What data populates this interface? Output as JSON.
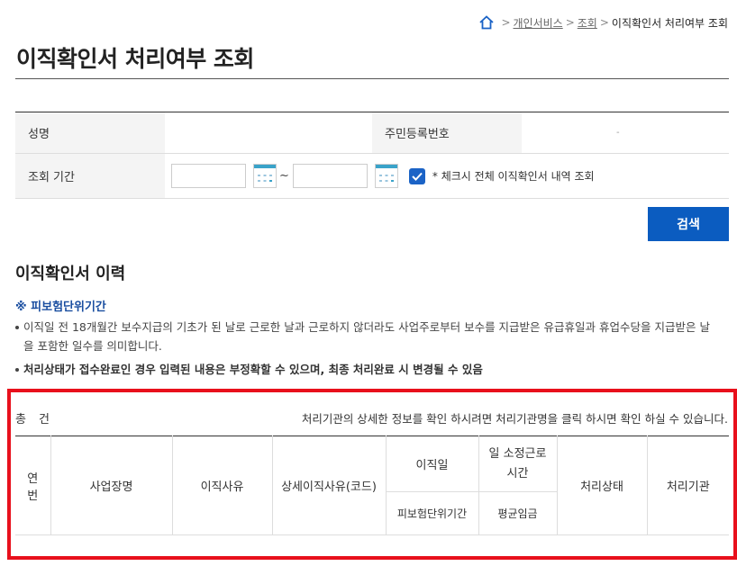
{
  "breadcrumb": {
    "home_icon": "home-icon",
    "items": [
      "개인서비스",
      "조회"
    ],
    "current": "이직확인서 처리여부 조회"
  },
  "page_title": "이직확인서 처리여부 조회",
  "form": {
    "name_label": "성명",
    "name_value": "",
    "id_label": "주민등록번호",
    "id_value": "-",
    "period_label": "조회 기간",
    "date_from": "",
    "date_to": "",
    "tilde": "~",
    "check_all_checked": true,
    "check_all_label": "* 체크시 전체 이직확인서 내역 조회"
  },
  "search_button": "검색",
  "history": {
    "section_title": "이직확인서 이력",
    "note_title": "※ 피보험단위기간",
    "bullet1": "이직일 전 18개월간 보수지급의 기초가 된 날로 근로한 날과 근로하지 않더라도 사업주로부터 보수를 지급받은 유급휴일과 휴업수당을 지급받은 날을 포함한 일수를 의미합니다.",
    "bullet2": "처리상태가 접수완료인 경우 입력된 내용은 부정확할 수 있으며, 최종 처리완료 시 변경될 수 있음"
  },
  "results": {
    "total_label": "총",
    "total_unit": "건",
    "hint": "처리기관의 상세한 정보를 확인 하시려면 처리기관명을 클릭 하시면 확인 하실 수 있습니다.",
    "headers": {
      "seq_line1": "연",
      "seq_line2": "번",
      "workplace": "사업장명",
      "reason": "이직사유",
      "detail_reason": "상세이직사유(코드)",
      "leave_date": "이직일",
      "daily_hours_line1": "일 소정근로",
      "daily_hours_line2": "시간",
      "status": "처리상태",
      "agency": "처리기관",
      "insured_period": "피보험단위기간",
      "avg_wage": "평균임금"
    }
  },
  "colors": {
    "accent": "#0b5cc0",
    "checkbox": "#1b63c6",
    "note": "#1a4ea0",
    "highlight_border": "#e8101c"
  }
}
